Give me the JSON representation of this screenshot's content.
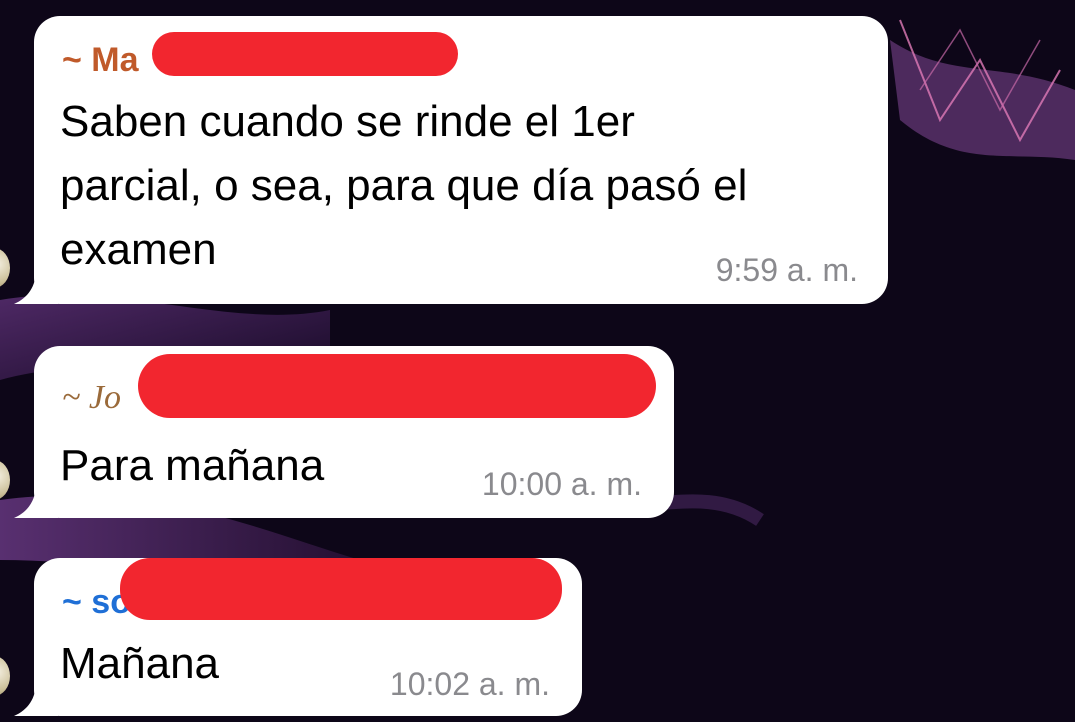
{
  "chat": {
    "messages": [
      {
        "sender": "~ Ma",
        "sender_color": "#c05a2a",
        "text": "Saben cuando se rinde el 1er\nparcial, o sea, para que día pasó el\nexamen",
        "time": "9:59 a. m."
      },
      {
        "sender": "~ Jo",
        "sender_color": "#9a6a3a",
        "text": "Para mañana",
        "time": "10:00 a. m."
      },
      {
        "sender": "~ so",
        "sender_color": "#1f6fd6",
        "text": "Mañana",
        "time": "10:02 a. m."
      }
    ]
  },
  "colors": {
    "bubble": "#ffffff",
    "redaction": "#f2262f",
    "timestamp": "#8a8a8e",
    "wallpaper": "#0d0618"
  }
}
